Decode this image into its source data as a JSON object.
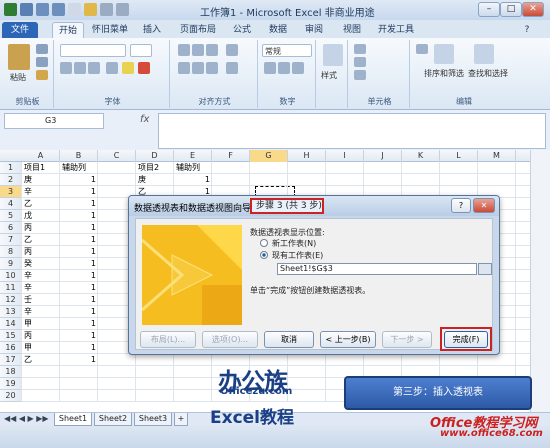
{
  "window": {
    "title": "工作簿1 - Microsoft Excel 非商业用途"
  },
  "ribbon": {
    "tabs": [
      "文件",
      "开始",
      "怀旧菜单",
      "插入",
      "页面布局",
      "公式",
      "数据",
      "审阅",
      "视图",
      "开发工具"
    ],
    "groups": {
      "clipboard": "剪贴板",
      "font": "字体",
      "alignment": "对齐方式",
      "number": "数字",
      "cells": "单元格",
      "editing": "编辑"
    },
    "paste_label": "粘贴",
    "number_format": "常规",
    "styles_label": "样式",
    "cells_label": "单元格",
    "sort_label": "排序和筛选",
    "find_label": "查找和选择"
  },
  "formula_bar": {
    "name_box": "G3",
    "fx": "fx",
    "formula": ""
  },
  "sheet": {
    "columns": [
      "A",
      "B",
      "C",
      "D",
      "E",
      "F",
      "G",
      "H",
      "I",
      "J",
      "K",
      "L",
      "M"
    ],
    "rows": [
      "1",
      "2",
      "3",
      "4",
      "5",
      "6",
      "7",
      "8",
      "9",
      "10",
      "11",
      "12",
      "13",
      "14",
      "15",
      "16",
      "17",
      "18",
      "19",
      "20"
    ],
    "col_a": [
      "项目1",
      "庚",
      "辛",
      "乙",
      "戊",
      "丙",
      "乙",
      "丙",
      "癸",
      "辛",
      "辛",
      "壬",
      "辛",
      "甲",
      "丙",
      "甲",
      "乙"
    ],
    "col_b": [
      "辅助列",
      "1",
      "1",
      "1",
      "1",
      "1",
      "1",
      "1",
      "1",
      "1",
      "1",
      "1",
      "1",
      "1",
      "1",
      "1",
      "1"
    ],
    "col_d": [
      "项目2",
      "庚",
      "乙"
    ],
    "col_e": [
      "辅助列",
      "1",
      "1"
    ],
    "tabs": [
      "Sheet1",
      "Sheet2",
      "Sheet3"
    ]
  },
  "dialog": {
    "title": "数据透视表和数据透视图向导 -",
    "step": "步骤 3 (共 3 步)",
    "help": "?",
    "close": "✕",
    "prompt": "数据透视表显示位置:",
    "option_new": "新工作表(N)",
    "option_existing": "现有工作表(E)",
    "location": "Sheet1!$G$3",
    "hint": "单击“完成”按钮创建数据透视表。",
    "buttons": {
      "layout": "布局(L)...",
      "options": "选项(O)...",
      "cancel": "取消",
      "back": "< 上一步(B)",
      "next": "下一步 >",
      "finish": "完成(F)"
    }
  },
  "watermark": {
    "logo_cn": "办公族",
    "logo_url": "Officezu.com",
    "logo_en": "Excel教程",
    "banner": "第三步：插入透视表",
    "site_name": "Office教程学习网",
    "site_url": "www.office68.com"
  },
  "colors": {
    "accent": "#2d65b7",
    "highlight": "#cc2222",
    "dialog_image": "#f5bd1f"
  }
}
